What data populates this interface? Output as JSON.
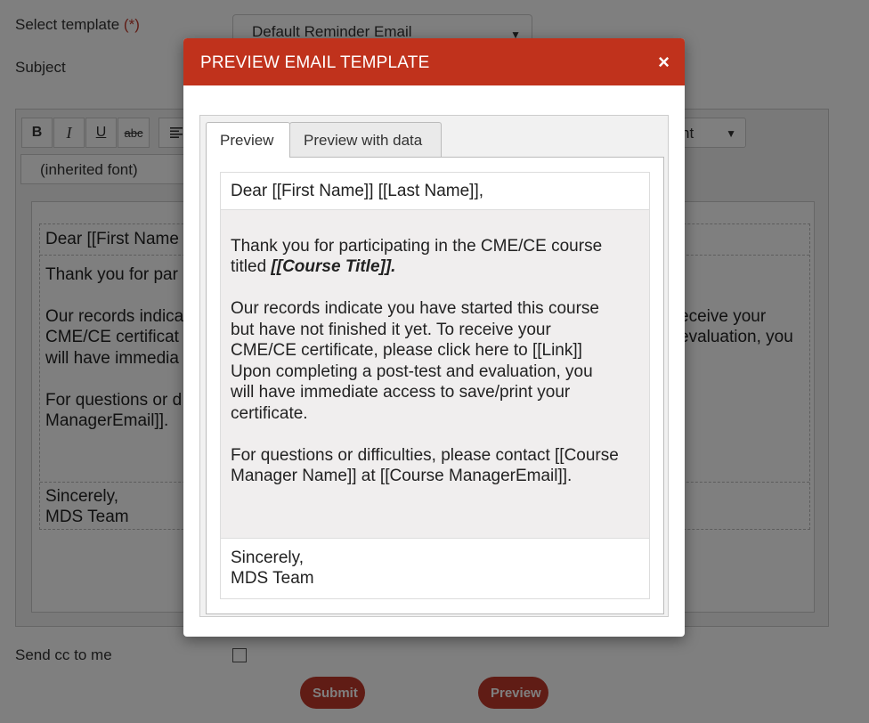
{
  "form": {
    "template_label": "Select template",
    "required_mark": "(*)",
    "template_value": "Default Reminder Email",
    "subject_label": "Subject",
    "cc_label": "Send cc to me",
    "submit_label": "Submit",
    "preview_label": "Preview"
  },
  "editor": {
    "bold": "B",
    "italic": "I",
    "underline": "U",
    "strike": "abc",
    "font_value": "(inherited font)",
    "format_value": "nt",
    "body": {
      "greeting": "Dear [[First Name",
      "line1": "Thank you for par",
      "line2a": "Our records indica",
      "line2b": "CME/CE certificat",
      "line2c": "will have immedia",
      "line2d_right1": "eceive your",
      "line2d_right2": "evaluation, you",
      "line3a": "For questions or d",
      "line3b": "ManagerEmail]].",
      "closing1": "Sincerely,",
      "closing2": "MDS Team"
    }
  },
  "modal": {
    "title": "PREVIEW EMAIL TEMPLATE",
    "close": "×",
    "tabs": [
      {
        "label": "Preview",
        "active": true
      },
      {
        "label": "Preview with data",
        "active": false
      }
    ],
    "email": {
      "greeting": "Dear [[First Name]] [[Last Name]],",
      "para1_text": "Thank you for participating in the CME/CE course titled ",
      "para1_course": "[[Course Title]].",
      "para2_lines": [
        "Our records indicate you have started this course",
        "but have not finished it yet. To receive your",
        "CME/CE certificate, please click here to [[Link]]",
        "Upon completing a post-test and evaluation, you",
        "will have immediate access to save/print your",
        "certificate."
      ],
      "para3_lines": [
        "For questions or difficulties, please contact [[Course",
        "Manager Name]] at [[Course ManagerEmail]]."
      ],
      "closing1": "Sincerely,",
      "closing2": "MDS Team"
    }
  },
  "colors": {
    "header": "#c0321c",
    "button": "#c0392b"
  }
}
